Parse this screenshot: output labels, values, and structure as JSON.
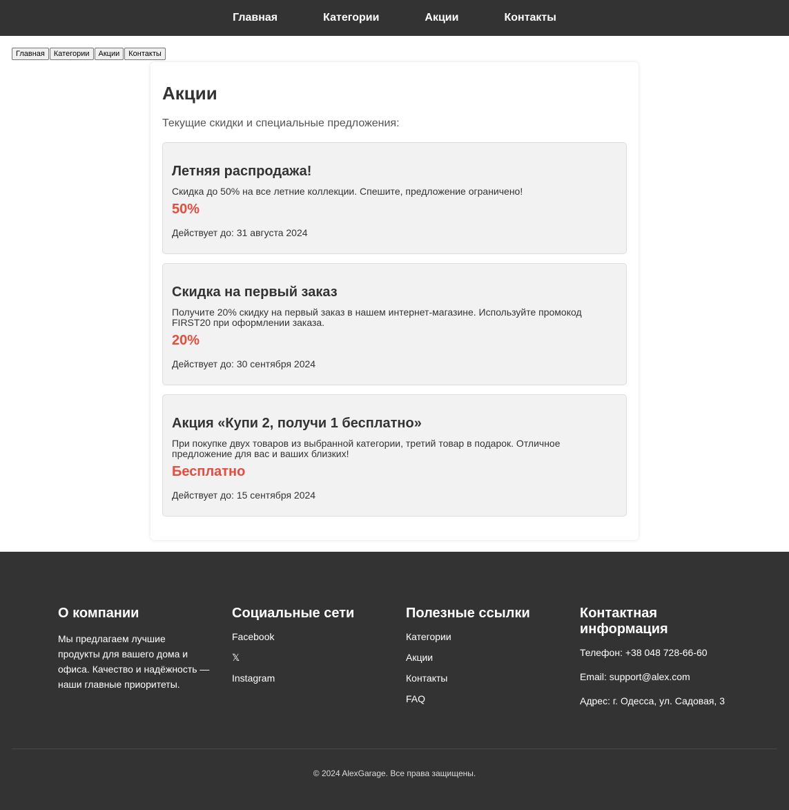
{
  "topnav": {
    "items": [
      "Главная",
      "Категории",
      "Акции",
      "Контакты"
    ]
  },
  "subnav": {
    "items": [
      "Главная",
      "Категории",
      "Акции",
      "Контакты"
    ]
  },
  "main": {
    "title": "Акции",
    "intro": "Текущие скидки и специальные предложения:",
    "promos": [
      {
        "title": "Летняя распродажа!",
        "desc": "Скидка до 50% на все летние коллекции. Спешите, предложение ограничено!",
        "value": "50%",
        "valid": "Действует до: 31 августа 2024"
      },
      {
        "title": "Скидка на первый заказ",
        "desc": "Получите 20% скидку на первый заказ в нашем интернет-магазине. Используйте промокод FIRST20 при оформлении заказа.",
        "value": "20%",
        "valid": "Действует до: 30 сентября 2024"
      },
      {
        "title": "Акция «Купи 2, получи 1 бесплатно»",
        "desc": "При покупке двух товаров из выбранной категории, третий товар в подарок. Отличное предложение для вас и ваших близких!",
        "value": "Бесплатно",
        "valid": "Действует до: 15 сентября 2024"
      }
    ]
  },
  "footer": {
    "about": {
      "title": "О компании",
      "text": "Мы предлагаем лучшие продукты для вашего дома и офиса. Качество и надёжность — наши главные приоритеты."
    },
    "social": {
      "title": "Социальные сети",
      "links": [
        "Facebook",
        "𝕏",
        "Instagram"
      ]
    },
    "useful": {
      "title": "Полезные ссылки",
      "links": [
        "Категории",
        "Акции",
        "Контакты",
        "FAQ"
      ]
    },
    "contact": {
      "title": "Контактная информация",
      "phone": "Телефон: +38 048 728-66-60",
      "email": "Email: support@alex.com",
      "address": "Адрес: г. Одесса, ул. Садовая, 3"
    },
    "copyright": "© 2024 AlexGarage. Все права защищены."
  },
  "colors": {
    "nav_bg": "#333333",
    "accent": "#e74c3c",
    "card_bg": "#f2f2f2"
  }
}
